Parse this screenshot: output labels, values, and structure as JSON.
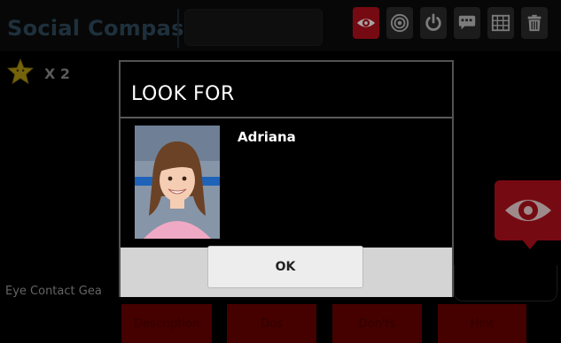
{
  "app": {
    "title": "Social Compass"
  },
  "toolbar": {
    "icons": [
      {
        "name": "eye",
        "active": true
      },
      {
        "name": "target",
        "active": false
      },
      {
        "name": "power",
        "active": false
      },
      {
        "name": "chat",
        "active": false
      },
      {
        "name": "grid",
        "active": false
      },
      {
        "name": "trash",
        "active": false
      }
    ]
  },
  "reward": {
    "count_label": "X 2"
  },
  "gear": {
    "label": "Eye Contact Gea"
  },
  "tabs": {
    "description": "Description",
    "dos": "Dos",
    "donts": "Don'ts",
    "hint": "Hint"
  },
  "dialog": {
    "title": "LOOK FOR",
    "person_name": "Adriana",
    "ok_label": "OK"
  },
  "colors": {
    "accent": "#b5101c",
    "tab": "#6b0000",
    "title": "#2f4a5c"
  }
}
